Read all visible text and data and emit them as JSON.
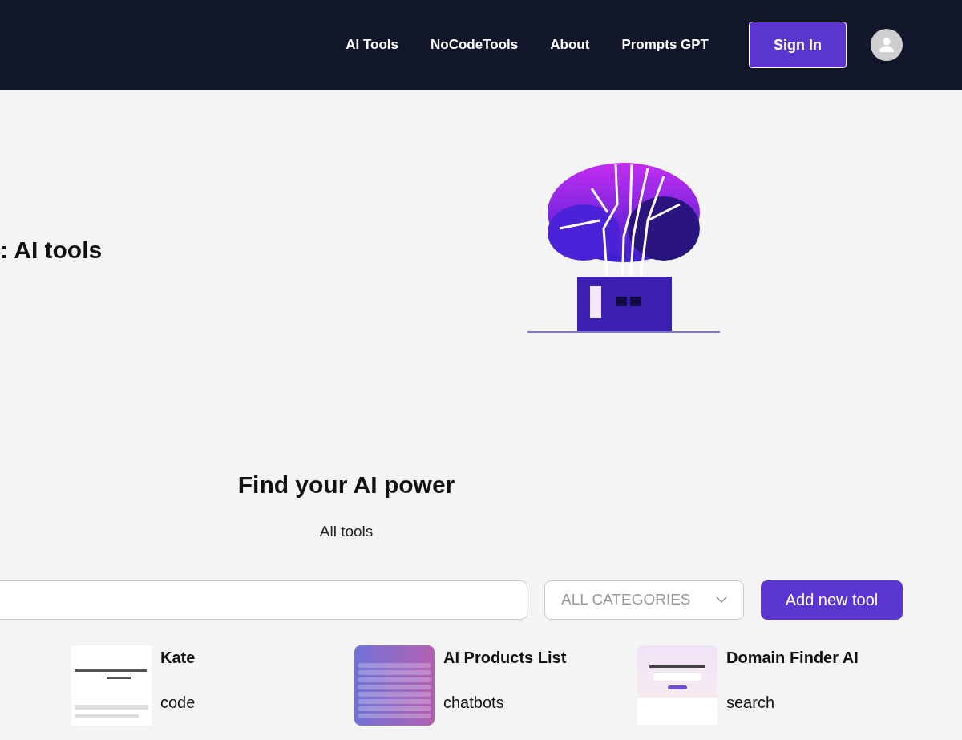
{
  "nav": {
    "links": [
      {
        "label": "AI Tools"
      },
      {
        "label": "NoCodeTools"
      },
      {
        "label": "About"
      },
      {
        "label": "Prompts GPT"
      }
    ],
    "sign_in": "Sign In"
  },
  "hero": {
    "title": ": AI tools"
  },
  "section": {
    "title": "Find your AI power",
    "subtitle": "All tools"
  },
  "filters": {
    "category": "ALL CATEGORIES",
    "add_button": "Add new tool"
  },
  "tools": [
    {
      "name": "Kate",
      "category": "code",
      "kind": "light"
    },
    {
      "name": "AI Products List",
      "category": "chatbots",
      "kind": "table"
    },
    {
      "name": "Domain Finder AI",
      "category": "search",
      "kind": "pastel"
    }
  ]
}
